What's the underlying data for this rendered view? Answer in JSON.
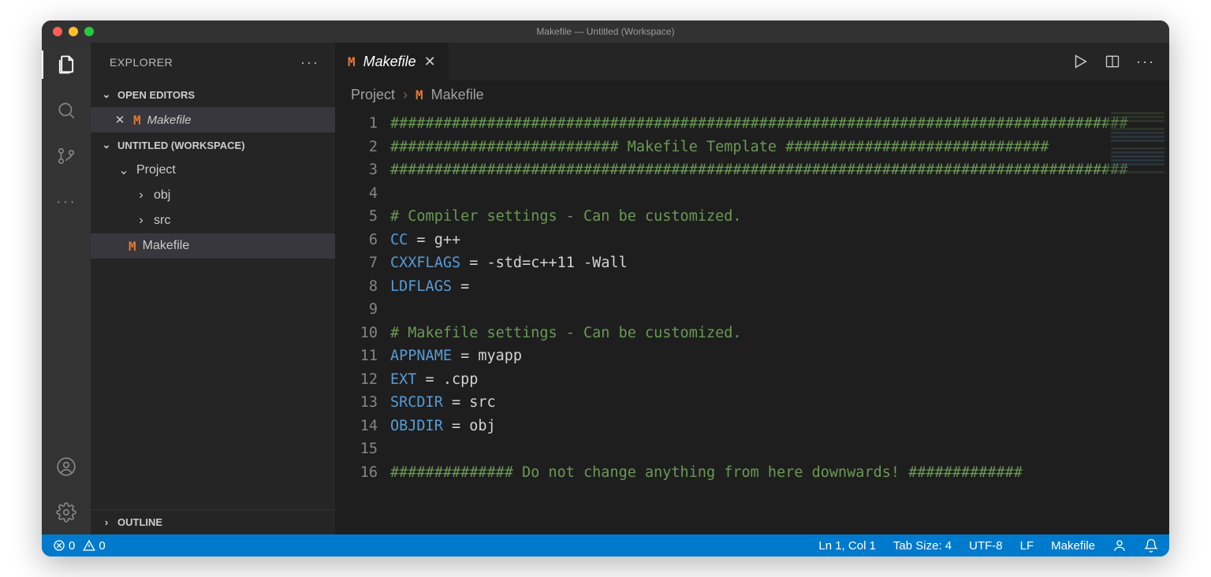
{
  "window": {
    "title": "Makefile — Untitled (Workspace)"
  },
  "sidebar": {
    "title": "EXPLORER",
    "sections": {
      "openEditors": {
        "label": "OPEN EDITORS",
        "items": [
          {
            "name": "Makefile"
          }
        ]
      },
      "workspace": {
        "label": "UNTITLED (WORKSPACE)",
        "tree": {
          "root": "Project",
          "folders": [
            "obj",
            "src"
          ],
          "files": [
            "Makefile"
          ]
        }
      },
      "outline": {
        "label": "OUTLINE"
      }
    }
  },
  "tabs": {
    "active": "Makefile"
  },
  "breadcrumbs": {
    "parts": [
      "Project",
      "Makefile"
    ]
  },
  "code": {
    "lines": [
      {
        "n": 1,
        "t": "comment",
        "text": "####################################################################################"
      },
      {
        "n": 2,
        "t": "comment",
        "text": "########################## Makefile Template ##############################"
      },
      {
        "n": 3,
        "t": "comment",
        "text": "####################################################################################"
      },
      {
        "n": 4,
        "t": "blank",
        "text": ""
      },
      {
        "n": 5,
        "t": "comment",
        "text": "# Compiler settings - Can be customized."
      },
      {
        "n": 6,
        "t": "assign",
        "key": "CC",
        "val": "g++"
      },
      {
        "n": 7,
        "t": "assign",
        "key": "CXXFLAGS",
        "val": "-std=c++11 -Wall"
      },
      {
        "n": 8,
        "t": "assign",
        "key": "LDFLAGS",
        "val": ""
      },
      {
        "n": 9,
        "t": "blank",
        "text": ""
      },
      {
        "n": 10,
        "t": "comment",
        "text": "# Makefile settings - Can be customized."
      },
      {
        "n": 11,
        "t": "assign",
        "key": "APPNAME",
        "val": "myapp"
      },
      {
        "n": 12,
        "t": "assign",
        "key": "EXT",
        "val": ".cpp"
      },
      {
        "n": 13,
        "t": "assign",
        "key": "SRCDIR",
        "val": "src"
      },
      {
        "n": 14,
        "t": "assign",
        "key": "OBJDIR",
        "val": "obj"
      },
      {
        "n": 15,
        "t": "blank",
        "text": ""
      },
      {
        "n": 16,
        "t": "comment",
        "text": "############## Do not change anything from here downwards! #############"
      }
    ]
  },
  "status": {
    "errors": "0",
    "warnings": "0",
    "cursor": "Ln 1, Col 1",
    "tabsize": "Tab Size: 4",
    "encoding": "UTF-8",
    "eol": "LF",
    "language": "Makefile"
  }
}
